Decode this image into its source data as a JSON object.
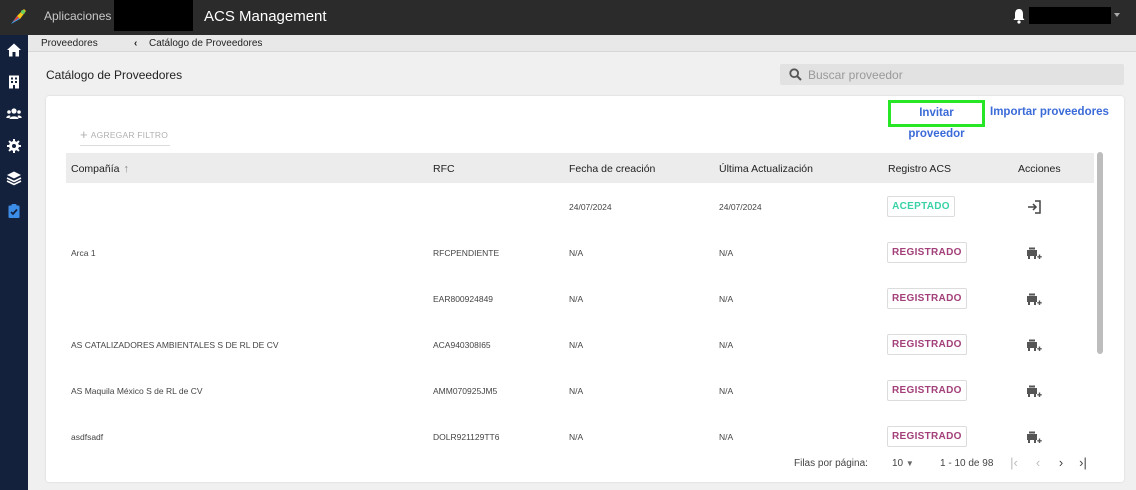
{
  "topbar": {
    "apps_label": "Aplicaciones",
    "app_title": "ACS Management"
  },
  "breadcrumb": {
    "parent": "Proveedores",
    "separator": "‹",
    "current": "Catálogo de Proveedores"
  },
  "page": {
    "title": "Catálogo de Proveedores",
    "search_placeholder": "Buscar proveedor"
  },
  "actions": {
    "invite": "Invitar proveedor",
    "import": "Importar proveedores",
    "add_filter": "AGREGAR FILTRO"
  },
  "table": {
    "columns": [
      "Compañía",
      "RFC",
      "Fecha de creación",
      "Última Actualización",
      "Registro ACS",
      "Acciones"
    ],
    "rows": [
      {
        "company": "",
        "rfc": "",
        "created": "24/07/2024",
        "updated": "24/07/2024",
        "status": "ACEPTADO",
        "action_icon": "login-icon"
      },
      {
        "company": "Arca 1",
        "rfc": "RFCPENDIENTE",
        "created": "N/A",
        "updated": "N/A",
        "status": "REGISTRADO",
        "action_icon": "add-to-queue-icon"
      },
      {
        "company": "",
        "rfc": "EAR800924849",
        "created": "N/A",
        "updated": "N/A",
        "status": "REGISTRADO",
        "action_icon": "add-to-queue-icon"
      },
      {
        "company": "AS CATALIZADORES AMBIENTALES S DE RL DE CV",
        "rfc": "ACA940308I65",
        "created": "N/A",
        "updated": "N/A",
        "status": "REGISTRADO",
        "action_icon": "add-to-queue-icon"
      },
      {
        "company": "AS Maquila México S de RL de CV",
        "rfc": "AMM070925JM5",
        "created": "N/A",
        "updated": "N/A",
        "status": "REGISTRADO",
        "action_icon": "add-to-queue-icon"
      },
      {
        "company": "asdfsadf",
        "rfc": "DOLR921129TT6",
        "created": "N/A",
        "updated": "N/A",
        "status": "REGISTRADO",
        "action_icon": "add-to-queue-icon"
      }
    ]
  },
  "pagination": {
    "rows_label": "Filas por página:",
    "rows_value": "10",
    "range": "1 - 10 de 98",
    "first": "|‹",
    "prev": "‹",
    "next": "›",
    "last": "›|"
  },
  "colors": {
    "topbar": "#2b2b2b",
    "sidebar": "#14213d",
    "accent": "#3b6bd8",
    "accepted": "#39d2a6",
    "registered": "#a3407a",
    "highlight": "#26e626"
  }
}
